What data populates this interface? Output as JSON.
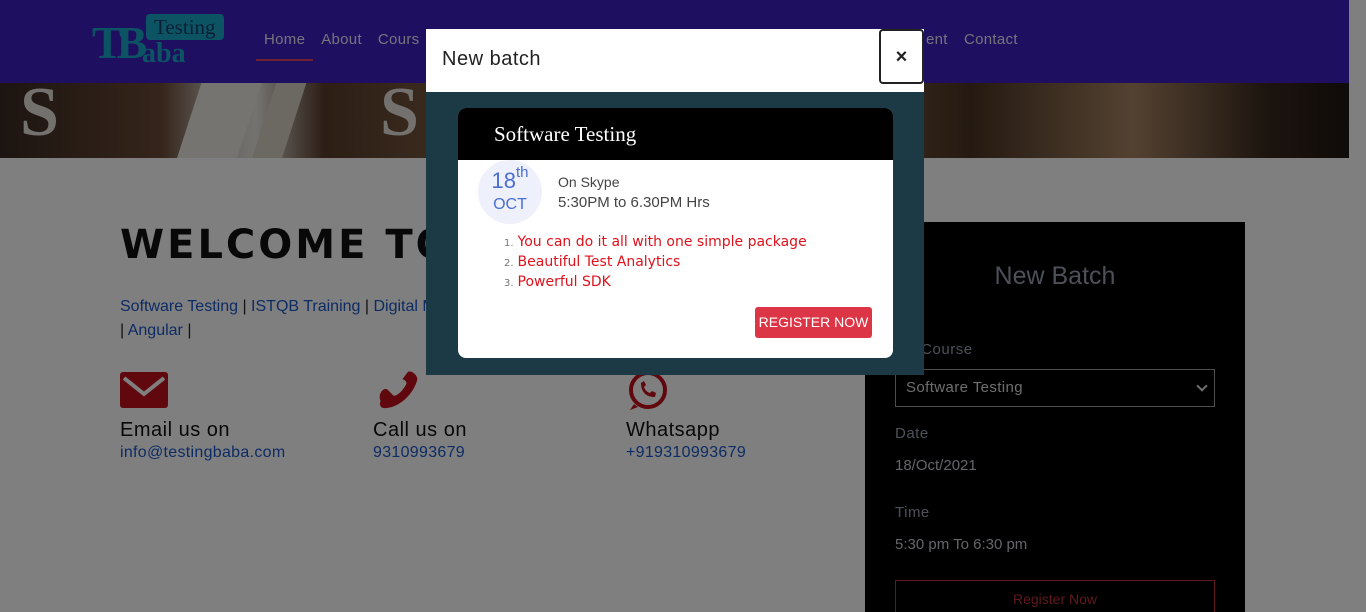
{
  "header": {
    "logo": {
      "text_tb": "TB",
      "text_testing": "Testing",
      "text_aba": "aba"
    },
    "nav": [
      {
        "label": "Home",
        "active": true
      },
      {
        "label": "About"
      },
      {
        "label": "Cours"
      },
      {
        "label": "ent"
      },
      {
        "label": "Contact"
      }
    ]
  },
  "main": {
    "welcome": "WELCOME TO",
    "links": [
      "Software Testing",
      "ISTQB Training",
      "Digital M",
      "Angular"
    ],
    "contacts": [
      {
        "icon": "envelope-icon",
        "title": "Email us on",
        "value": "info@testingbaba.com"
      },
      {
        "icon": "phone-icon",
        "title": "Call us on",
        "value": "9310993679"
      },
      {
        "icon": "whatsapp-icon",
        "title": "Whatsapp",
        "value": "+919310993679"
      }
    ]
  },
  "sidebar": {
    "heading": "New Batch",
    "course_label": "ect Course",
    "course_value": "Software Testing",
    "date_label": "Date",
    "date_value": "18/Oct/2021",
    "time_label": "Time",
    "time_value": "5:30 pm To 6:30 pm",
    "register": "Register Now"
  },
  "modal": {
    "title": "New batch",
    "close": "×",
    "card": {
      "title": "Software Testing",
      "day": "18",
      "day_suffix": "th",
      "month": "OCT",
      "where": "On Skype",
      "time": "5:30PM to 6.30PM Hrs",
      "features": [
        "You can do it all with one simple package",
        "Beautiful Test Analytics",
        "Powerful SDK"
      ],
      "register": "REGISTER NOW"
    }
  },
  "colors": {
    "header_bg": "#3c1fc2",
    "accent_red": "#dc3545",
    "modal_bg": "#1c3a46"
  }
}
